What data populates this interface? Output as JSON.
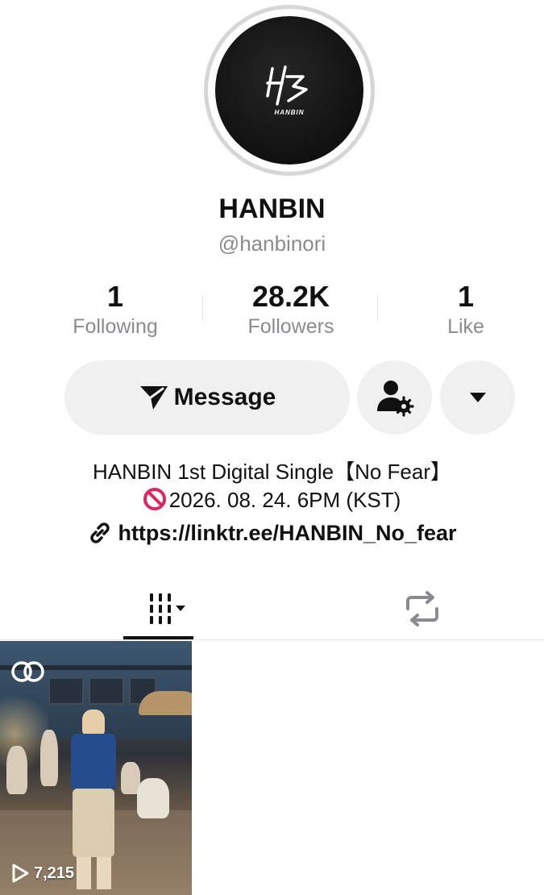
{
  "profile": {
    "display_name": "HANBIN",
    "username": "@hanbinori",
    "avatar_wordmark": "HANBIN"
  },
  "stats": {
    "following_count": "1",
    "following_label": "Following",
    "followers_count": "28.2K",
    "followers_label": "Followers",
    "likes_count": "1",
    "likes_label": "Like"
  },
  "actions": {
    "message_label": "Message",
    "add_friend_icon": "person-gear-icon",
    "more_icon": "caret-down-icon"
  },
  "bio": {
    "line1": "HANBIN 1st Digital Single【No Fear】",
    "line2": "2026. 08. 24. 6PM (KST)",
    "line2_emoji": "no-entry-icon",
    "link": "https://linktr.ee/HANBIN_No_fear"
  },
  "tabs": [
    {
      "icon": "grid-icon",
      "active": true
    },
    {
      "icon": "repost-icon",
      "active": false
    }
  ],
  "videos": [
    {
      "views": "7,215",
      "badge_icon": "collab-icon"
    }
  ],
  "colors": {
    "text_primary": "#111111",
    "text_secondary": "#8a8b91",
    "button_bg": "#f0f0f1",
    "forbid_red": "#e0245e"
  }
}
